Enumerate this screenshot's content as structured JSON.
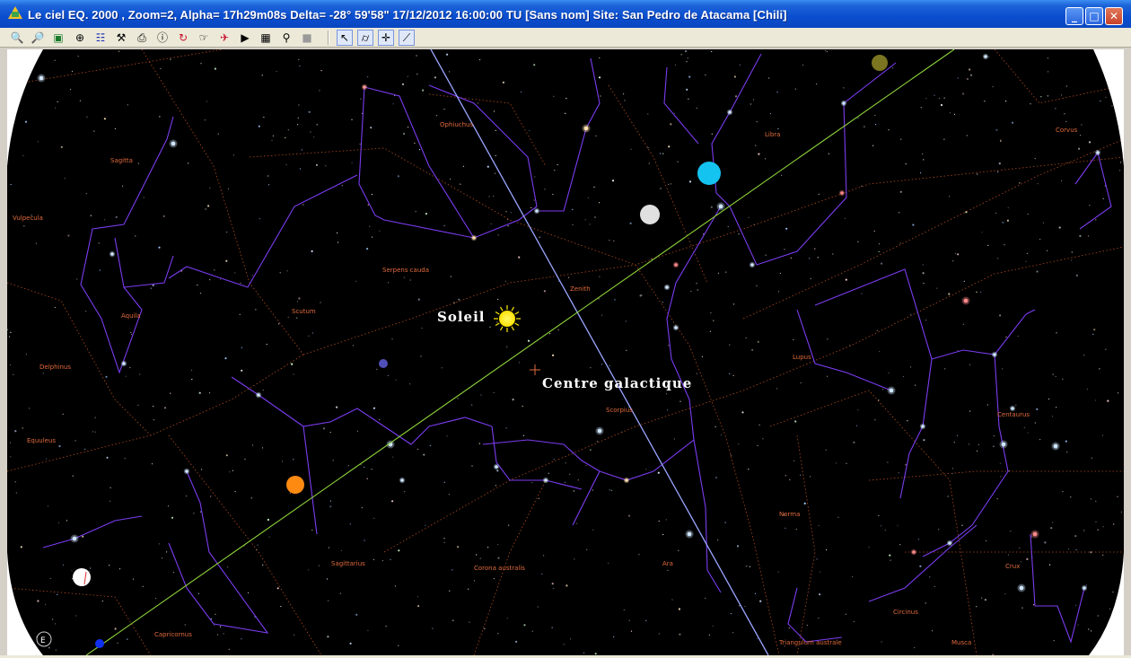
{
  "window": {
    "title": "Le ciel EQ. 2000 , Zoom=2, Alpha= 17h29m08s Delta= -28° 59'58\"     17/12/2012 16:00:00 TU [Sans nom]    Site: San Pedro de Atacama [Chili]",
    "buttons": [
      "minimize-icon",
      "maximize-icon",
      "close-icon"
    ]
  },
  "toolbar": {
    "items": [
      {
        "icon": "zoom-out-icon",
        "glyph": "🔍"
      },
      {
        "icon": "zoom-in-icon",
        "glyph": "🔎"
      },
      {
        "icon": "image-icon",
        "glyph": "▣"
      },
      {
        "icon": "globe-icon",
        "glyph": "⊕"
      },
      {
        "icon": "catalog-icon",
        "glyph": "☷"
      },
      {
        "icon": "telescope-icon",
        "glyph": "⚒"
      },
      {
        "icon": "print-icon",
        "glyph": "⎙"
      },
      {
        "icon": "info-icon",
        "glyph": "ⓘ"
      },
      {
        "icon": "refresh-icon",
        "glyph": "↻"
      },
      {
        "icon": "pointer-hand-icon",
        "glyph": "☞"
      },
      {
        "icon": "rocket-icon",
        "glyph": "✈"
      },
      {
        "icon": "play-icon",
        "glyph": "▶"
      },
      {
        "icon": "table-icon",
        "glyph": "▦"
      },
      {
        "icon": "search-object-icon",
        "glyph": "⚲"
      },
      {
        "icon": "grey-square-icon",
        "glyph": "■"
      },
      {
        "icon": "cursor-arrow-icon",
        "glyph": "↖"
      },
      {
        "icon": "binoculars-icon",
        "glyph": "⌭"
      },
      {
        "icon": "crosshair-icon",
        "glyph": "✛"
      },
      {
        "icon": "measure-icon",
        "glyph": "⟋"
      }
    ]
  },
  "sky": {
    "labels": {
      "sun": "Soleil",
      "galactic_center": "Centre galactique",
      "compass": "E"
    },
    "constellations": [
      "Ophiuchus",
      "Libra",
      "Sagitta",
      "Vulpecula",
      "Serpens cauda",
      "Scutum",
      "Aquila",
      "Delphinus",
      "Equuleus",
      "Zenith",
      "Scorpius",
      "Lupus",
      "Centaurus",
      "Corvus",
      "Norma",
      "Sagittarius",
      "Corona australis",
      "Ara",
      "Circinus",
      "Triangulum australe",
      "Crux",
      "Capricornus",
      "Musca"
    ],
    "colors": {
      "background": "#000000",
      "ecliptic": "#8fd43a",
      "meridian": "#9aa6ff",
      "constellation_lines": "#7b3cf0",
      "boundaries": "#b04a1c",
      "labels": "#e06a3b",
      "sun": "#ffea00",
      "neptune": "#14c3f0",
      "moon_disc": "#e0e0e0",
      "mars": "#ff8a12",
      "saturn": "#7b7420"
    }
  }
}
